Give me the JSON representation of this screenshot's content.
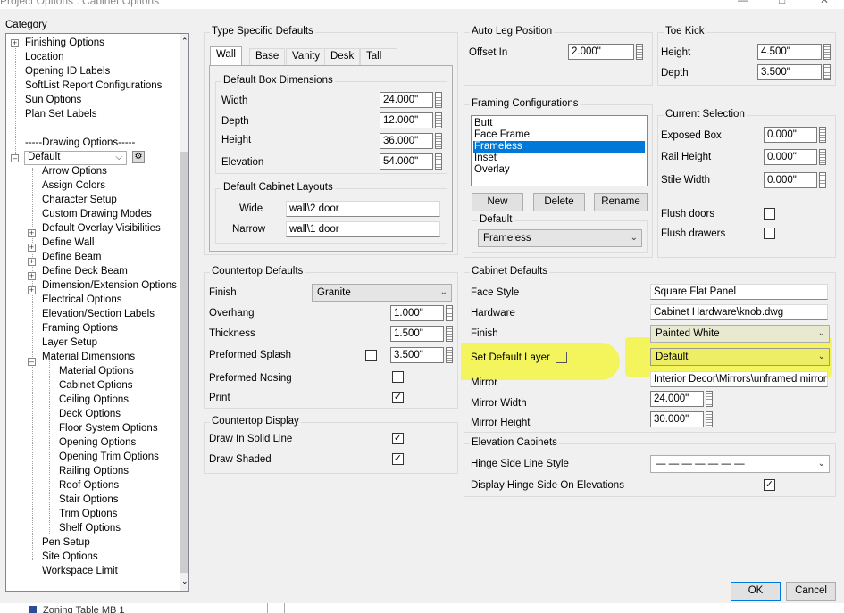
{
  "window": {
    "title": "Project Options : Cabinet Options"
  },
  "category_label": "Category",
  "tree": {
    "items": [
      "Finishing Options",
      "Location",
      "Opening ID Labels",
      "SoftList Report Configurations",
      "Sun Options",
      "Plan Set Labels",
      "-----Drawing Options-----"
    ],
    "default_combo": "Default",
    "children": [
      "Arrow Options",
      "Assign Colors",
      "Character Setup",
      "Custom Drawing Modes",
      "Default Overlay Visibilities",
      "Define Wall",
      "Define Beam",
      "Define Deck Beam",
      "Dimension/Extension Options",
      "Electrical Options",
      "Elevation/Section Labels",
      "Framing Options",
      "Layer Setup",
      "Material Dimensions"
    ],
    "material_children": [
      "Material Options",
      "Cabinet Options",
      "Ceiling Options",
      "Deck Options",
      "Floor System Options",
      "Opening Options",
      "Opening Trim Options",
      "Railing Options",
      "Roof Options",
      "Stair Options",
      "Trim Options",
      "Shelf Options"
    ],
    "tail": [
      "Pen Setup",
      "Site Options",
      "Workspace Limit"
    ]
  },
  "type_defaults": {
    "title": "Type Specific Defaults",
    "tabs": [
      "Wall",
      "Base",
      "Vanity",
      "Desk",
      "Tall"
    ],
    "box_title": "Default Box Dimensions",
    "rows": [
      {
        "label": "Width",
        "value": "24.000\""
      },
      {
        "label": "Depth",
        "value": "12.000\""
      },
      {
        "label": "Height",
        "value": "36.000\""
      },
      {
        "label": "Elevation",
        "value": "54.000\""
      }
    ],
    "layouts_title": "Default Cabinet Layouts",
    "layouts": [
      {
        "label": "Wide",
        "value": "wall\\2 door"
      },
      {
        "label": "Narrow",
        "value": "wall\\1 door"
      }
    ]
  },
  "auto_leg": {
    "title": "Auto Leg Position",
    "label": "Offset In",
    "value": "2.000\""
  },
  "toe_kick": {
    "title": "Toe Kick",
    "height_label": "Height",
    "height": "4.500\"",
    "depth_label": "Depth",
    "depth": "3.500\""
  },
  "framing": {
    "title": "Framing Configurations",
    "items": [
      "Butt",
      "Face Frame",
      "Frameless",
      "Inset",
      "Overlay"
    ],
    "selected": 2,
    "buttons": {
      "new": "New",
      "delete": "Delete",
      "rename": "Rename"
    },
    "default_title": "Default",
    "default_value": "Frameless"
  },
  "current_selection": {
    "title": "Current Selection",
    "exposed_box": "Exposed Box",
    "exposed_val": "0.000\"",
    "rail_height": "Rail Height",
    "rail_val": "0.000\"",
    "stile_width": "Stile Width",
    "stile_val": "0.000\"",
    "flush_doors": "Flush doors",
    "flush_drawers": "Flush drawers"
  },
  "countertop": {
    "title": "Countertop Defaults",
    "finish_label": "Finish",
    "finish": "Granite",
    "overhang_label": "Overhang",
    "overhang": "1.000\"",
    "thickness_label": "Thickness",
    "thickness": "1.500\"",
    "splash_label": "Preformed Splash",
    "splash": "3.500\"",
    "nosing_label": "Preformed Nosing",
    "print_label": "Print"
  },
  "countertop_display": {
    "title": "Countertop Display",
    "solid": "Draw In Solid Line",
    "shaded": "Draw Shaded"
  },
  "cabinet_defaults": {
    "title": "Cabinet Defaults",
    "face_label": "Face Style",
    "face": "Square Flat Panel",
    "hardware_label": "Hardware",
    "hardware": "Cabinet Hardware\\knob.dwg",
    "finish_label": "Finish",
    "finish": "Painted White",
    "layer_label": "Set Default Layer",
    "layer": "Default",
    "mirror_label": "Mirror",
    "mirror": "Interior Decor\\Mirrors\\unframed mirror",
    "mirror_w_label": "Mirror Width",
    "mirror_w": "24.000\"",
    "mirror_h_label": "Mirror Height",
    "mirror_h": "30.000\""
  },
  "elevation": {
    "title": "Elevation Cabinets",
    "hinge_label": "Hinge Side Line Style",
    "hinge_value": "— — — — — — —",
    "display_label": "Display Hinge Side On Elevations"
  },
  "buttons": {
    "ok": "OK",
    "cancel": "Cancel"
  },
  "bottom_strip": {
    "text": "Zoning Table MB 1"
  },
  "highlight_color": "#f5f538"
}
